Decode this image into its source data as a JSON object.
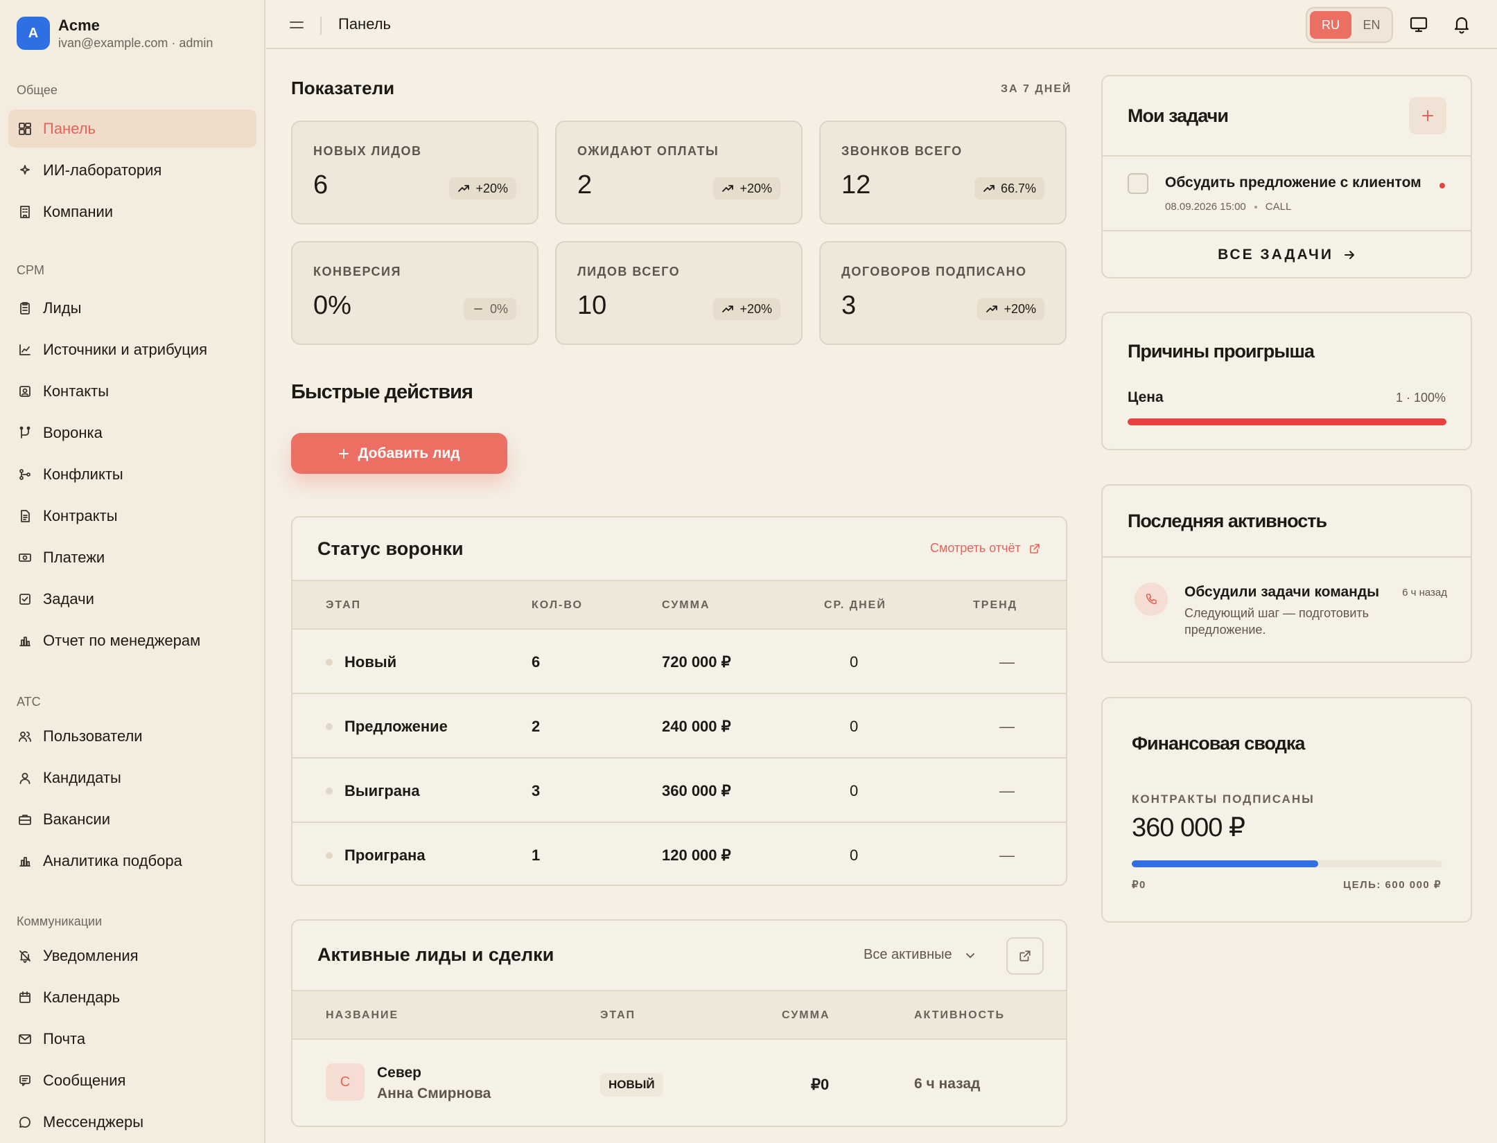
{
  "brand": {
    "initial": "A",
    "name": "Acme",
    "sub": "ivan@example.com · admin"
  },
  "nav": {
    "sections": [
      {
        "title": "Общее",
        "items": [
          {
            "label": "Панель",
            "icon": "dashboard-icon",
            "active": true
          },
          {
            "label": "ИИ-лаборатория",
            "icon": "sparkle-icon"
          },
          {
            "label": "Компании",
            "icon": "building-icon"
          }
        ]
      },
      {
        "title": "CPM",
        "items": [
          {
            "label": "Лиды",
            "icon": "clipboard-icon"
          },
          {
            "label": "Источники и атрибуция",
            "icon": "line-chart-icon"
          },
          {
            "label": "Контакты",
            "icon": "contact-card-icon"
          },
          {
            "label": "Воронка",
            "icon": "pipeline-icon"
          },
          {
            "label": "Конфликты",
            "icon": "git-branch-icon"
          },
          {
            "label": "Контракты",
            "icon": "document-icon"
          },
          {
            "label": "Платежи",
            "icon": "money-icon"
          },
          {
            "label": "Задачи",
            "icon": "checkbox-icon"
          },
          {
            "label": "Отчет по менеджерам",
            "icon": "bar-chart-icon"
          }
        ]
      },
      {
        "title": "ATC",
        "items": [
          {
            "label": "Пользователи",
            "icon": "users-icon"
          },
          {
            "label": "Кандидаты",
            "icon": "user-icon"
          },
          {
            "label": "Вакансии",
            "icon": "briefcase-icon"
          },
          {
            "label": "Аналитика подбора",
            "icon": "bar-chart-icon"
          }
        ]
      },
      {
        "title": "Коммуникации",
        "items": [
          {
            "label": "Уведомления",
            "icon": "bell-off-icon"
          },
          {
            "label": "Календарь",
            "icon": "calendar-icon"
          },
          {
            "label": "Почта",
            "icon": "mail-icon"
          },
          {
            "label": "Сообщения",
            "icon": "message-icon"
          },
          {
            "label": "Мессенджеры",
            "icon": "chat-icon"
          }
        ]
      }
    ]
  },
  "header": {
    "title": "Панель",
    "lang_ru": "RU",
    "lang_en": "EN"
  },
  "metrics": {
    "title": "Показатели",
    "period": "ЗА 7 ДНЕЙ",
    "cards": [
      {
        "label": "НОВЫХ ЛИДОВ",
        "value": "6",
        "badge": "+20%",
        "trend": "up"
      },
      {
        "label": "ОЖИДАЮТ ОПЛАТЫ",
        "value": "2",
        "badge": "+20%",
        "trend": "up"
      },
      {
        "label": "ЗВОНКОВ ВСЕГО",
        "value": "12",
        "badge": "66.7%",
        "trend": "up"
      },
      {
        "label": "КОНВЕРСИЯ",
        "value": "0%",
        "badge": "0%",
        "trend": "flat"
      },
      {
        "label": "ЛИДОВ ВСЕГО",
        "value": "10",
        "badge": "+20%",
        "trend": "up"
      },
      {
        "label": "ДОГОВОРОВ ПОДПИСАНО",
        "value": "3",
        "badge": "+20%",
        "trend": "up"
      }
    ]
  },
  "quick": {
    "title": "Быстрые действия",
    "add_lead": "Добавить лид"
  },
  "funnel": {
    "title": "Статус воронки",
    "report_link": "Смотреть отчёт",
    "columns": [
      "ЭТАП",
      "КОЛ-ВО",
      "СУММА",
      "СР. ДНЕЙ",
      "ТРЕНД"
    ],
    "rows": [
      {
        "stage": "Новый",
        "count": "6",
        "sum": "720 000 ₽",
        "days": "0",
        "trend": "—"
      },
      {
        "stage": "Предложение",
        "count": "2",
        "sum": "240 000 ₽",
        "days": "0",
        "trend": "—"
      },
      {
        "stage": "Выиграна",
        "count": "3",
        "sum": "360 000 ₽",
        "days": "0",
        "trend": "—"
      },
      {
        "stage": "Проиграна",
        "count": "1",
        "sum": "120 000 ₽",
        "days": "0",
        "trend": "—"
      }
    ]
  },
  "leads": {
    "title": "Активные лиды и сделки",
    "filter": "Все активные",
    "columns": [
      "НАЗВАНИЕ",
      "ЭТАП",
      "СУММА",
      "АКТИВНОСТЬ"
    ],
    "rows": [
      {
        "initial": "С",
        "name": "Север",
        "contact": "Анна Смирнова",
        "stage": "НОВЫЙ",
        "sum": "₽0",
        "activity": "6 ч назад"
      }
    ]
  },
  "tasks": {
    "title": "Мои задачи",
    "item": {
      "title": "Обсудить предложение с клиентом",
      "date": "08.09.2026 15:00",
      "type": "CALL"
    },
    "all": "ВСЕ ЗАДАЧИ"
  },
  "loss": {
    "title": "Причины проигрыша",
    "reason": "Цена",
    "value": "1 · 100%",
    "fraction": 1.0
  },
  "activity": {
    "title": "Последняя активность",
    "item_title": "Обсудили задачи команды",
    "item_time": "6 ч назад",
    "item_desc_1": "Следующий шаг — подготовить",
    "item_desc_2": "предложение."
  },
  "finance": {
    "title": "Финансовая сводка",
    "label": "КОНТРАКТЫ ПОДПИСАНЫ",
    "value": "360 000 ₽",
    "min": "₽0",
    "goal": "ЦЕЛЬ: 600 000 ₽",
    "fraction": 0.6
  },
  "colors": {
    "accent": "#ec6f64",
    "blue": "#2f6fe4",
    "red": "#e8423f"
  }
}
